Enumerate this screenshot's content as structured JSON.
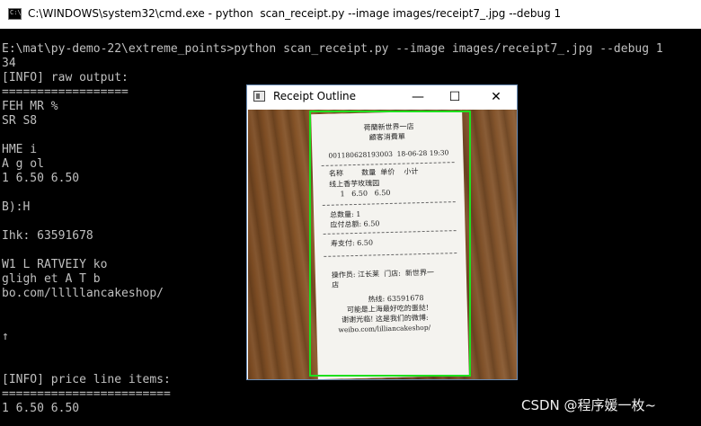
{
  "cmd_window": {
    "title": "C:\\WINDOWS\\system32\\cmd.exe - python  scan_receipt.py --image images/receipt7_.jpg --debug 1",
    "icon": "C:\\"
  },
  "console_lines": [
    "E:\\mat\\py-demo-22\\extreme_points>python scan_receipt.py --image images/receipt7_.jpg --debug 1",
    "34",
    "[INFO] raw output:",
    "==================",
    "FEH MR %",
    "SR S8",
    "",
    "HME i",
    "A g ol",
    "1 6.50 6.50",
    "",
    "B):H",
    "",
    "Ihk: 63591678",
    "",
    "W1 L RATVEIY ko",
    "gligh et A T b",
    "bo.com/lllllancakeshop/",
    "",
    "",
    "↑",
    "",
    "",
    "[INFO] price line items:",
    "========================",
    "1 6.50 6.50"
  ],
  "image_window": {
    "title": "Receipt Outline",
    "minimize": "—",
    "maximize": "☐",
    "close": "✕"
  },
  "receipt": {
    "header1": "荷蘭新世界一店",
    "header2": "顧客消費單",
    "order_line": "001180628193003  18-06-28 19:30",
    "columns": "名称        数量  单价    小计",
    "item_name": "线上香芋玫瑰园",
    "item_values": "1   6.50   6.50",
    "total_qty": "总数量: 1",
    "total_due": "应付总额: 6.50",
    "paid": "寿支付: 6.50",
    "operator": "操作员: 江长莱  门店:  新世界一",
    "operator2": "店",
    "hotline": "热线: 63591678",
    "slogan1": "可能是上海最好吃的蛋挞!",
    "slogan2": "谢谢光临! 这是我们的微博:",
    "weibo": "weibo.com/lilliancakeshop/"
  },
  "watermark": "CSDN @程序媛一枚~",
  "colors": {
    "outline": "#1ee01e",
    "console_bg": "#000000",
    "console_text": "#c0c0c0"
  }
}
